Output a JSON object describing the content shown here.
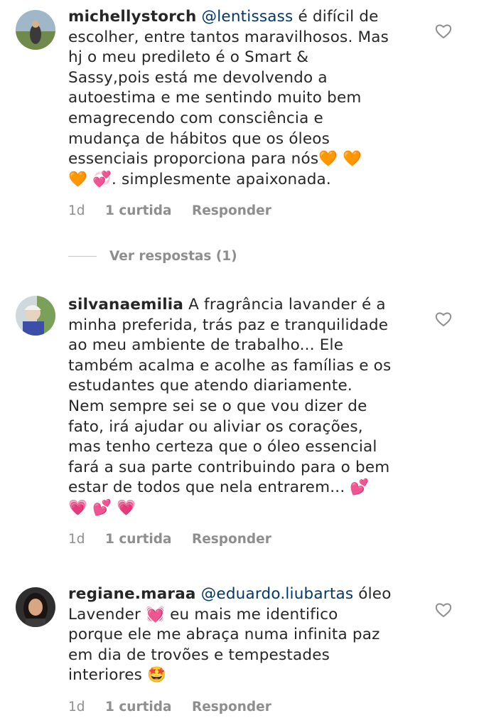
{
  "comments": [
    {
      "username": "michellystorch",
      "mention": "@lentissass",
      "text": " é difícil de\nescolher, entre tantos maravilhosos. Mas\nhj o meu predileto é o Smart &\nSassy,pois está me devolvendo a\nautoestima e me sentindo muito bem\nemagrecendo com consciência e\nmudança de hábitos que os óleos\nessenciais proporciona para nós🧡 🧡\n🧡 💞. simplesmente apaixonada.",
      "time": "1d",
      "likes": "1 curtida",
      "reply": "Responder",
      "view_replies": "Ver respostas (1)"
    },
    {
      "username": "silvanaemilia",
      "mention": "",
      "text": " A fragrância lavander é a\nminha preferida, trás paz e tranquilidade\nao meu ambiente de trabalho... Ele\ntambém acalma e acolhe as famílias e os\nestudantes que atendo diariamente.\nNem sempre sei se o que vou dizer de\nfato, irá ajudar ou aliviar os corações,\nmas tenho certeza que o óleo essencial\nfará a sua parte contribuindo para o bem\nestar de todos que nela entrarem... 💕\n💗 💕 💗",
      "time": "1d",
      "likes": "1 curtida",
      "reply": "Responder"
    },
    {
      "username": "regiane.maraa",
      "mention": "@eduardo.liubartas",
      "text": " óleo\nLavender 💓 eu mais me identifico\nporque ele me abraça numa infinita paz\nem dia de trovões e tempestades\ninteriores 🤩",
      "time": "1d",
      "likes": "1 curtida",
      "reply": "Responder"
    }
  ],
  "icons": {
    "like": "heart-outline-icon",
    "divider": "reply-line"
  },
  "colors": {
    "text": "#262626",
    "secondary": "#8e8e8e",
    "mention": "#00376b"
  }
}
